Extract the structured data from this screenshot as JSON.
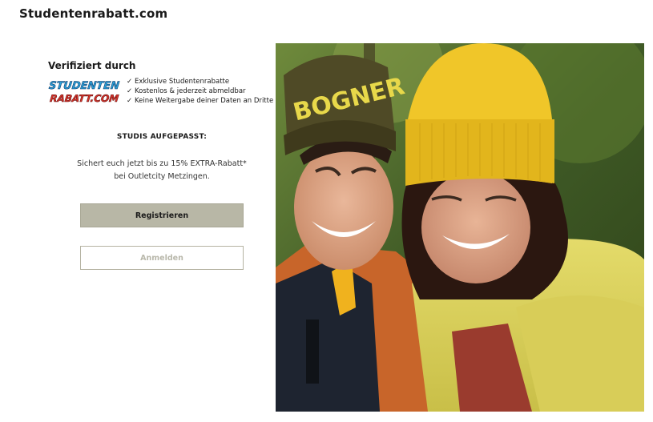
{
  "header": {
    "brand": "Studentenrabatt.com"
  },
  "verification": {
    "heading": "Verifiziert durch",
    "logo_line1": "STUDENTEN",
    "logo_line2": "RABATT.COM",
    "benefits": [
      "Exklusive Studentenrabatte",
      "Kostenlos & jederzeit abmeldbar",
      "Keine Weitergabe deiner Daten an Dritte"
    ],
    "check_glyph": "✓"
  },
  "promo": {
    "heading": "STUDIS AUFGEPASST:",
    "line1": "Sichert euch jetzt bis zu 15% EXTRA-Rabatt*",
    "line2": "bei Outletcity Metzingen."
  },
  "actions": {
    "register_label": "Registrieren",
    "login_label": "Anmelden"
  },
  "photo": {
    "beanie_text": "BOGNER"
  },
  "colors": {
    "register_bg": "#b8b7a6",
    "login_text": "#b9b8ab",
    "logo_blue": "#2a9fd8",
    "logo_red": "#d6342a"
  }
}
